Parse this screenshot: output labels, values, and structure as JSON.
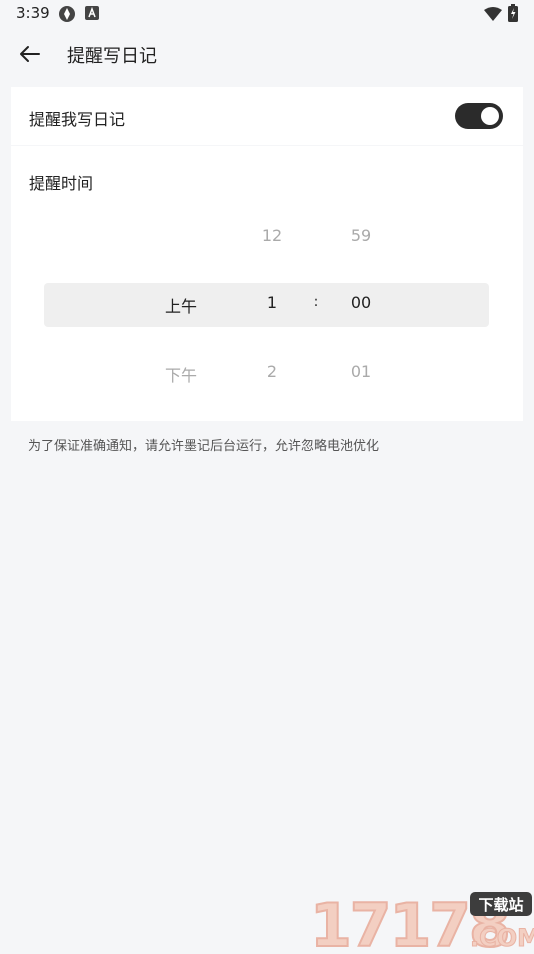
{
  "status_bar": {
    "time": "3:39"
  },
  "app_bar": {
    "title": "提醒写日记"
  },
  "reminder": {
    "label": "提醒我写日记",
    "enabled": true
  },
  "time_picker": {
    "label": "提醒时间",
    "ampm": {
      "selected": "上午",
      "next": "下午"
    },
    "hours": {
      "prev": "12",
      "selected": "1",
      "next": "2"
    },
    "separator": ":",
    "minutes": {
      "prev": "59",
      "selected": "00",
      "next": "01"
    }
  },
  "hint": "为了保证准确通知，请允许墨记后台运行，允许忽略电池优化",
  "watermark": {
    "digits": "17178",
    "suffix": "下载站",
    "domain": ".COM"
  },
  "colors": {
    "background": "#f5f6f8",
    "card": "#ffffff",
    "switch_on": "#2b2b2b",
    "picker_highlight": "#efefef"
  }
}
